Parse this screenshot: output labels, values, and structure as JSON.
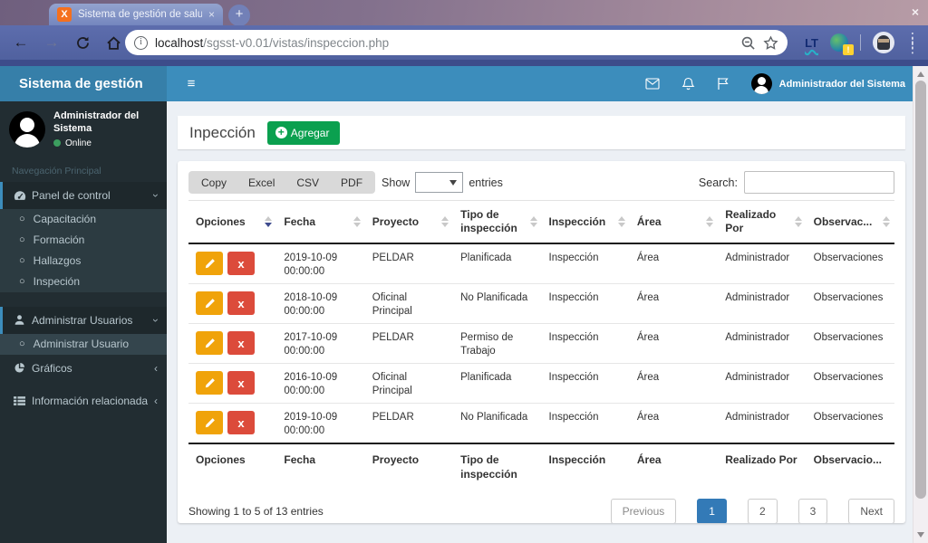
{
  "browser": {
    "tab_title": "Sistema de gestión de salu",
    "tab_close": "×",
    "favicon_glyph": "X",
    "new_tab": "+",
    "window_close": "×",
    "url_host": "localhost",
    "url_path": "/sgsst-v0.01/vistas/inspeccion.php",
    "info_glyph": "i",
    "ext_lt": "LT",
    "ext_badge": "!",
    "back_glyph": "←",
    "forward_glyph": "→",
    "menu_glyph": "⋮"
  },
  "navbar": {
    "brand": "Sistema de gestión",
    "hamburger_glyph": "≡",
    "user_name": "Administrador del Sistema"
  },
  "sidebar": {
    "user_name": "Administrador del Sistema",
    "user_status": "Online",
    "section_label": "Navegación Principal",
    "items": [
      {
        "label": "Panel de control"
      },
      {
        "label": "Capacitación"
      },
      {
        "label": "Formación"
      },
      {
        "label": "Hallazgos"
      },
      {
        "label": "Inspeción"
      },
      {
        "label": "Administrar Usuarios"
      },
      {
        "label": "Administrar Usuario"
      },
      {
        "label": "Gráficos"
      },
      {
        "label": "Información relacionada"
      }
    ],
    "bullet_glyph": "○",
    "chevron_expanded": "›",
    "chevron_collapsed": "‹"
  },
  "main": {
    "title": "Inpección",
    "add_button": "Agregar",
    "export_buttons": [
      "Copy",
      "Excel",
      "CSV",
      "PDF"
    ],
    "show_label": "Show",
    "entries_label": "entries",
    "search_label": "Search:",
    "table": {
      "headers": [
        "Opciones",
        "Fecha",
        "Proyecto",
        "Tipo de inspección",
        "Inspección",
        "Área",
        "Realizado Por",
        "Observac..."
      ],
      "footers": [
        "Opciones",
        "Fecha",
        "Proyecto",
        "Tipo de inspección",
        "Inspección",
        "Área",
        "Realizado Por",
        "Observacio..."
      ],
      "sorted_column": "Opciones",
      "rows": [
        {
          "fecha": "2019-10-09 00:00:00",
          "proyecto": "PELDAR",
          "tipo": "Planificada",
          "inspeccion": "Inspección",
          "area": "Área",
          "realizado": "Administrador",
          "observaciones": "Observaciones"
        },
        {
          "fecha": "2018-10-09 00:00:00",
          "proyecto": "Oficinal Principal",
          "tipo": "No Planificada",
          "inspeccion": "Inspección",
          "area": "Área",
          "realizado": "Administrador",
          "observaciones": "Observaciones"
        },
        {
          "fecha": "2017-10-09 00:00:00",
          "proyecto": "PELDAR",
          "tipo": "Permiso de Trabajo",
          "inspeccion": "Inspección",
          "area": "Área",
          "realizado": "Administrador",
          "observaciones": "Observaciones"
        },
        {
          "fecha": "2016-10-09 00:00:00",
          "proyecto": "Oficinal Principal",
          "tipo": "Planificada",
          "inspeccion": "Inspección",
          "area": "Área",
          "realizado": "Administrador",
          "observaciones": "Observaciones"
        },
        {
          "fecha": "2019-10-09 00:00:00",
          "proyecto": "PELDAR",
          "tipo": "No Planificada",
          "inspeccion": "Inspección",
          "area": "Área",
          "realizado": "Administrador",
          "observaciones": "Observaciones"
        }
      ]
    },
    "info": "Showing 1 to 5 of 13 entries",
    "pagination": {
      "previous": "Previous",
      "pages": [
        "1",
        "2",
        "3"
      ],
      "active": "1",
      "next": "Next"
    }
  },
  "icons": {
    "delete_glyph": "x"
  },
  "colors": {
    "navbar": "#3c8dbc",
    "brand": "#367fa9",
    "sidebar": "#222d32",
    "submenu": "#2c3b41",
    "add_green": "#0ba04f",
    "edit_orange": "#f0a30a",
    "delete_red": "#dc4b3b",
    "active_page": "#337ab7",
    "content_bg": "#ecf0f5"
  }
}
